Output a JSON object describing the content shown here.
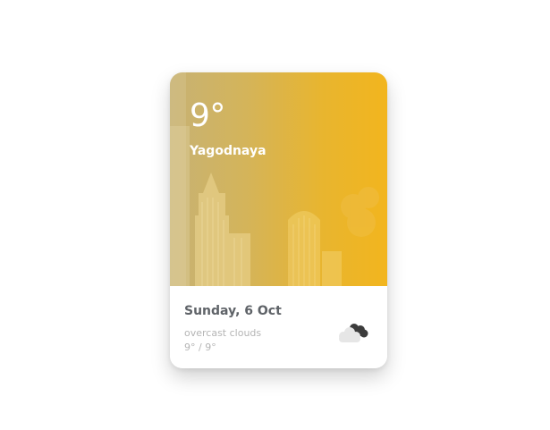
{
  "weather_card": {
    "temperature": "9°",
    "city": "Yagodnaya",
    "date": "Sunday, 6 Oct",
    "condition": "overcast clouds",
    "temp_range": "9° / 9°",
    "icon": "overcast-clouds-icon"
  },
  "colors": {
    "gradient_start": "#c7b274",
    "gradient_end": "#f2b51e",
    "date_text": "#5f6368",
    "secondary_text": "#b5b5b5"
  }
}
